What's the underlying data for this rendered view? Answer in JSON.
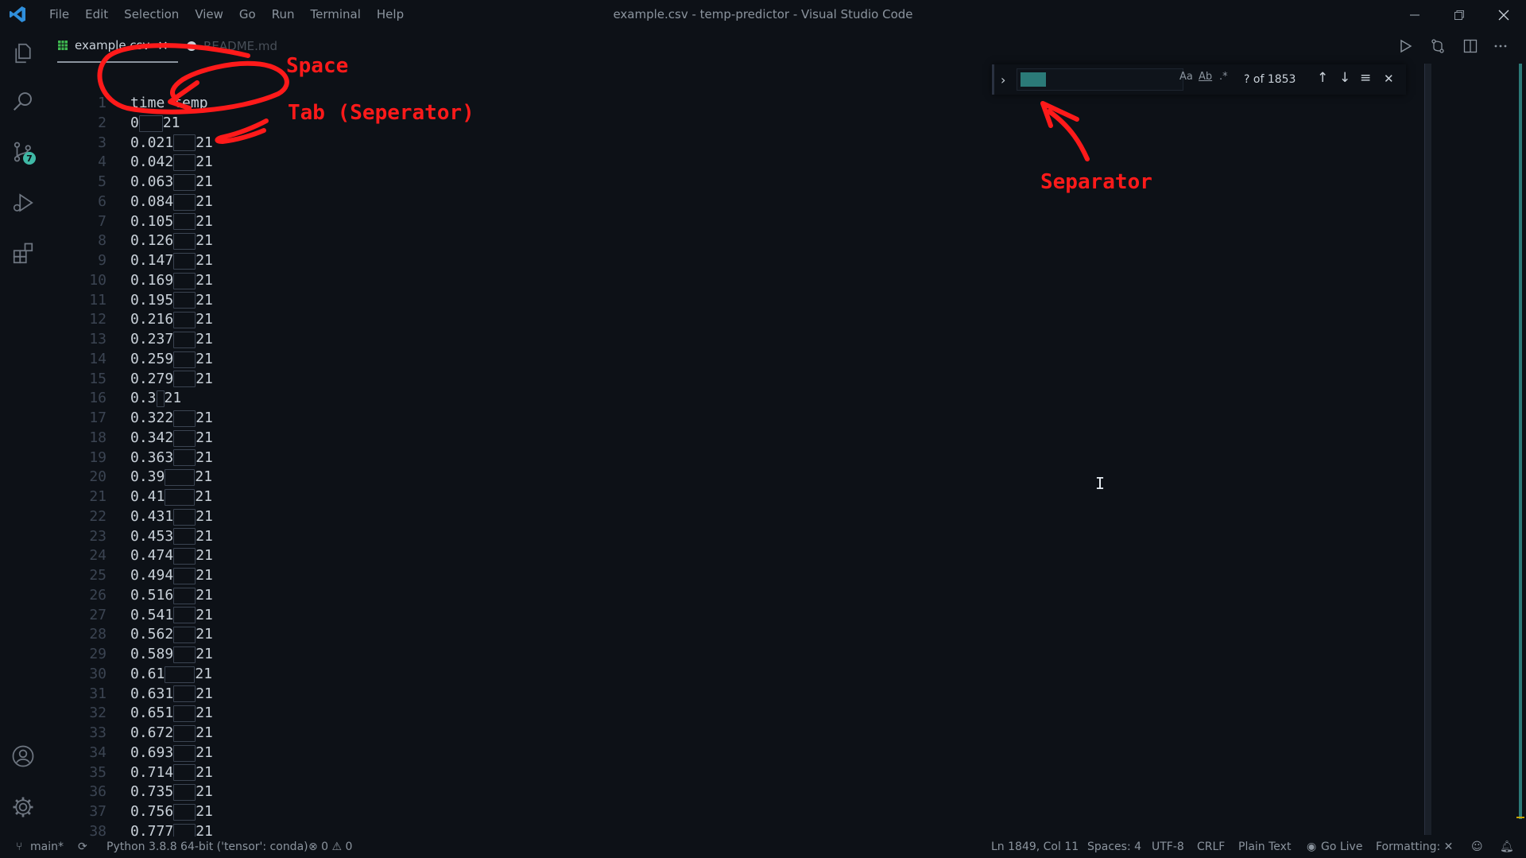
{
  "titlebar": {
    "title": "example.csv - temp-predictor - Visual Studio Code",
    "menu": [
      "File",
      "Edit",
      "Selection",
      "View",
      "Go",
      "Run",
      "Terminal",
      "Help"
    ]
  },
  "activity": {
    "scm_badge": "7"
  },
  "tabs": [
    {
      "label": "example.csv",
      "active": true,
      "close": "✕"
    },
    {
      "label": "README.md",
      "active": false
    }
  ],
  "find": {
    "toggle": "›",
    "match_case": "Aa",
    "whole_word": "Ab",
    "regex": ".*",
    "count": "? of 1853",
    "prev": "↑",
    "next": "↓",
    "selection": "≡",
    "close": "✕"
  },
  "annotations": {
    "space": "Space",
    "tab": "Tab (Seperator)",
    "separator": "Separator"
  },
  "lines": [
    {
      "n": "1",
      "a": "time",
      "t": "temp",
      "tab": 0
    },
    {
      "n": "2",
      "a": "0",
      "t": "21",
      "tab": 30
    },
    {
      "n": "3",
      "a": "0.021",
      "t": "21",
      "tab": 28
    },
    {
      "n": "4",
      "a": "0.042",
      "t": "21",
      "tab": 28
    },
    {
      "n": "5",
      "a": "0.063",
      "t": "21",
      "tab": 28
    },
    {
      "n": "6",
      "a": "0.084",
      "t": "21",
      "tab": 28
    },
    {
      "n": "7",
      "a": "0.105",
      "t": "21",
      "tab": 28
    },
    {
      "n": "8",
      "a": "0.126",
      "t": "21",
      "tab": 28
    },
    {
      "n": "9",
      "a": "0.147",
      "t": "21",
      "tab": 28
    },
    {
      "n": "10",
      "a": "0.169",
      "t": "21",
      "tab": 28
    },
    {
      "n": "11",
      "a": "0.195",
      "t": "21",
      "tab": 28
    },
    {
      "n": "12",
      "a": "0.216",
      "t": "21",
      "tab": 28
    },
    {
      "n": "13",
      "a": "0.237",
      "t": "21",
      "tab": 28
    },
    {
      "n": "14",
      "a": "0.259",
      "t": "21",
      "tab": 28
    },
    {
      "n": "15",
      "a": "0.279",
      "t": "21",
      "tab": 28
    },
    {
      "n": "16",
      "a": "0.3",
      "t": "21",
      "tab": 10
    },
    {
      "n": "17",
      "a": "0.322",
      "t": "21",
      "tab": 28
    },
    {
      "n": "18",
      "a": "0.342",
      "t": "21",
      "tab": 28
    },
    {
      "n": "19",
      "a": "0.363",
      "t": "21",
      "tab": 28
    },
    {
      "n": "20",
      "a": "0.39",
      "t": "21",
      "tab": 38
    },
    {
      "n": "21",
      "a": "0.41",
      "t": "21",
      "tab": 38
    },
    {
      "n": "22",
      "a": "0.431",
      "t": "21",
      "tab": 28
    },
    {
      "n": "23",
      "a": "0.453",
      "t": "21",
      "tab": 28
    },
    {
      "n": "24",
      "a": "0.474",
      "t": "21",
      "tab": 28
    },
    {
      "n": "25",
      "a": "0.494",
      "t": "21",
      "tab": 28
    },
    {
      "n": "26",
      "a": "0.516",
      "t": "21",
      "tab": 28
    },
    {
      "n": "27",
      "a": "0.541",
      "t": "21",
      "tab": 28
    },
    {
      "n": "28",
      "a": "0.562",
      "t": "21",
      "tab": 28
    },
    {
      "n": "29",
      "a": "0.589",
      "t": "21",
      "tab": 28
    },
    {
      "n": "30",
      "a": "0.61",
      "t": "21",
      "tab": 38
    },
    {
      "n": "31",
      "a": "0.631",
      "t": "21",
      "tab": 28
    },
    {
      "n": "32",
      "a": "0.651",
      "t": "21",
      "tab": 28
    },
    {
      "n": "33",
      "a": "0.672",
      "t": "21",
      "tab": 28
    },
    {
      "n": "34",
      "a": "0.693",
      "t": "21",
      "tab": 28
    },
    {
      "n": "35",
      "a": "0.714",
      "t": "21",
      "tab": 28
    },
    {
      "n": "36",
      "a": "0.735",
      "t": "21",
      "tab": 28
    },
    {
      "n": "37",
      "a": "0.756",
      "t": "21",
      "tab": 28
    },
    {
      "n": "38",
      "a": "0.777",
      "t": "21",
      "tab": 28
    }
  ],
  "statusbar": {
    "branch": "main*",
    "python": "Python 3.8.8 64-bit ('tensor': conda)",
    "problems": "⊗ 0 ⚠ 0",
    "position": "Ln 1849, Col 11",
    "spaces": "Spaces: 4",
    "encoding": "UTF-8",
    "eol": "CRLF",
    "language": "Plain Text",
    "golive": "Go Live",
    "formatting": "Formatting: ✕"
  }
}
